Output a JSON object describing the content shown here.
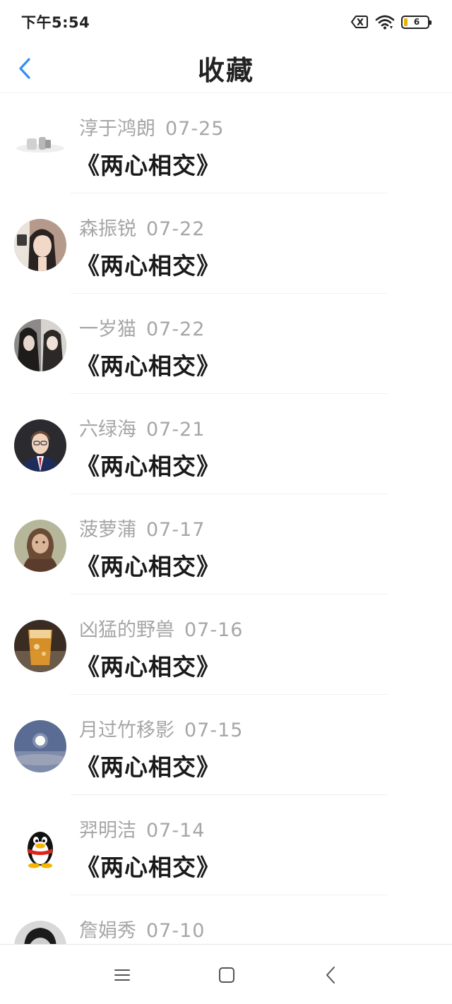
{
  "status_bar": {
    "time": "下午5:54",
    "battery_level": "6"
  },
  "header": {
    "title": "收藏"
  },
  "items": [
    {
      "name": "淳于鸿朗",
      "date": "07-25",
      "title": "《两心相交》",
      "avatar": "blurry-figure"
    },
    {
      "name": "森振锐",
      "date": "07-22",
      "title": "《两心相交》",
      "avatar": "girl-portrait"
    },
    {
      "name": "一岁猫",
      "date": "07-22",
      "title": "《两心相交》",
      "avatar": "dark-haired-girls"
    },
    {
      "name": "六绿海",
      "date": "07-21",
      "title": "《两心相交》",
      "avatar": "suited-man"
    },
    {
      "name": "菠萝蒲",
      "date": "07-17",
      "title": "《两心相交》",
      "avatar": "painting-lady"
    },
    {
      "name": "凶猛的野兽",
      "date": "07-16",
      "title": "《两心相交》",
      "avatar": "amber-drink"
    },
    {
      "name": "月过竹移影",
      "date": "07-15",
      "title": "《两心相交》",
      "avatar": "moon-sky"
    },
    {
      "name": "羿明洁",
      "date": "07-14",
      "title": "《两心相交》",
      "avatar": "qq-penguin"
    },
    {
      "name": "詹娟秀",
      "date": "07-10",
      "title": "",
      "avatar": "man-glasses"
    }
  ],
  "colors": {
    "accent": "#2f8ff0",
    "meta_gray": "#a6a6a6",
    "title_dark": "#1a1a1a"
  },
  "system_nav": {
    "icons": [
      "menu-icon",
      "home-square-icon",
      "back-chevron-icon"
    ]
  }
}
